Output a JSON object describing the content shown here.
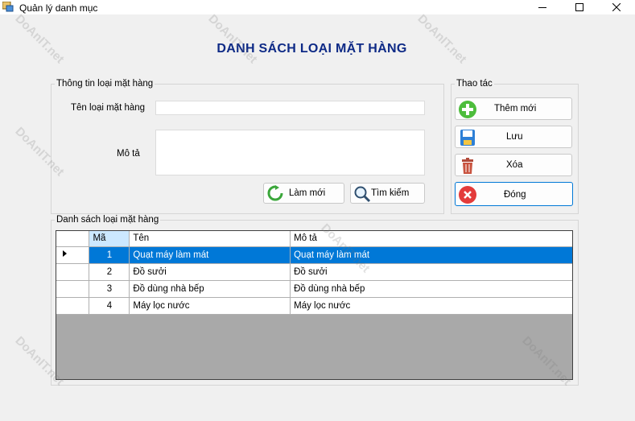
{
  "window": {
    "title": "Quản lý danh mục"
  },
  "heading": "DANH SÁCH LOẠI MẶT HÀNG",
  "info_group": {
    "legend": "Thông tin loại mặt hàng",
    "name_label": "Tên loại mặt hàng",
    "name_value": "",
    "desc_label": "Mô tả",
    "desc_value": "",
    "refresh_label": "Làm mới",
    "search_label": "Tìm kiếm"
  },
  "actions_group": {
    "legend": "Thao tác",
    "add_label": "Thêm mới",
    "save_label": "Lưu",
    "delete_label": "Xóa",
    "close_label": "Đóng"
  },
  "list_group": {
    "legend": "Danh sách loại mặt hàng",
    "columns": [
      "Mã",
      "Tên",
      "Mô tả"
    ],
    "rows": [
      {
        "id": "1",
        "name": "Quạt máy làm mát",
        "desc": "Quạt máy làm mát"
      },
      {
        "id": "2",
        "name": "Đồ sưởi",
        "desc": "Đồ sưởi"
      },
      {
        "id": "3",
        "name": "Đồ dùng nhà bếp",
        "desc": "Đồ dùng nhà bếp"
      },
      {
        "id": "4",
        "name": "Máy lọc nước",
        "desc": "Máy lọc nước"
      }
    ],
    "selected_row": 0
  },
  "watermark": "DoAnIT.net",
  "colors": {
    "accent": "#0078d7",
    "heading": "#0e2a86"
  }
}
